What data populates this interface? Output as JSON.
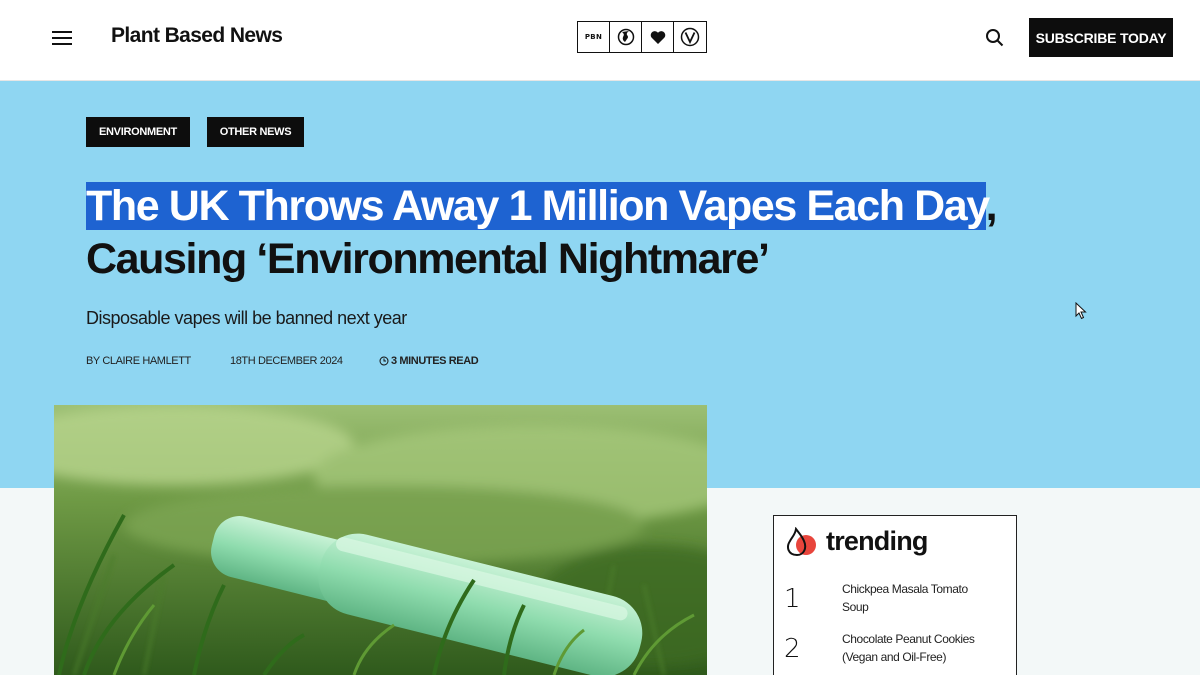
{
  "header": {
    "brand": "Plant Based News",
    "icon_strip": [
      {
        "name": "pbn-logo-icon",
        "text": "PBN"
      },
      {
        "name": "globe-icon"
      },
      {
        "name": "heart-icon"
      },
      {
        "name": "vegan-v-icon"
      }
    ],
    "subscribe_label": "SUBSCRIBE TODAY"
  },
  "article": {
    "tags": [
      "ENVIRONMENT",
      "OTHER NEWS"
    ],
    "title_highlighted": "The UK Throws Away 1 Million Vapes Each Day",
    "title_rest": ", Causing ‘Environmental Nightmare’",
    "subtitle": "Disposable vapes will be banned next year",
    "author": "BY CLAIRE HAMLETT",
    "date": "18TH DECEMBER 2024",
    "read_time": "3 MINUTES READ"
  },
  "trending": {
    "title": "trending",
    "items": [
      {
        "num": "1",
        "text": "Chickpea Masala Tomato Soup"
      },
      {
        "num": "2",
        "text": "Chocolate Peanut Cookies (Vegan and Oil-Free)"
      }
    ]
  },
  "colors": {
    "hero_bg": "#8fd6f2",
    "highlight": "#1e63d1",
    "dark": "#0d0d0d",
    "page_bg": "#f3f8f8"
  }
}
